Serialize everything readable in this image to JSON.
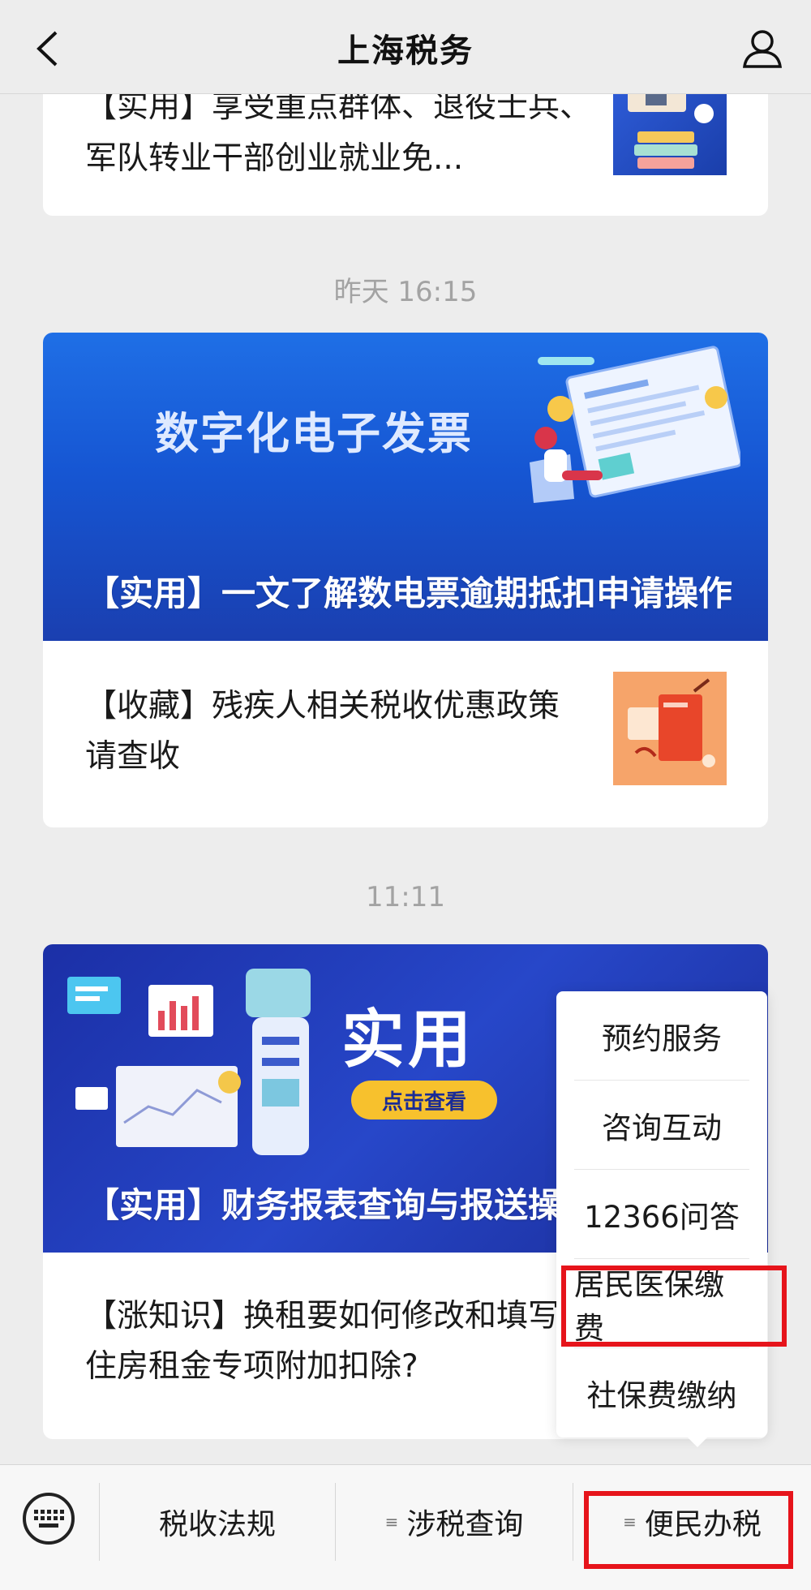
{
  "header": {
    "title": "上海税务"
  },
  "feed": {
    "top_card": {
      "text": "【实用】享受重点群体、退役士兵、军队转业干部创业就业免..."
    },
    "timestamp1": "昨天 16:15",
    "group1": {
      "banner_headline": "数字化电子发票",
      "banner_caption": "【实用】一文了解数电票逾期抵扣申请操作",
      "sub_item": "【收藏】残疾人相关税收优惠政策请查收"
    },
    "timestamp2": "11:11",
    "group2": {
      "banner_headline": "实用",
      "banner_button": "点击查看",
      "banner_caption": "【实用】财务报表查询与报送操作?",
      "sub_item": "【涨知识】换租要如何修改和填写住房租金专项附加扣除?"
    }
  },
  "popup_menu": {
    "items": [
      "预约服务",
      "咨询互动",
      "12366问答",
      "居民医保缴费",
      "社保费缴纳"
    ],
    "highlighted_item": "居民医保缴费"
  },
  "bottom_bar": {
    "tabs": [
      {
        "label": "税收法规",
        "has_submenu": false
      },
      {
        "label": "涉税查询",
        "has_submenu": true
      },
      {
        "label": "便民办税",
        "has_submenu": true
      }
    ],
    "highlighted_tab": "便民办税"
  },
  "colors": {
    "highlight": "#e6141b",
    "background": "#ededed",
    "banner_blue": "#1656d3"
  }
}
